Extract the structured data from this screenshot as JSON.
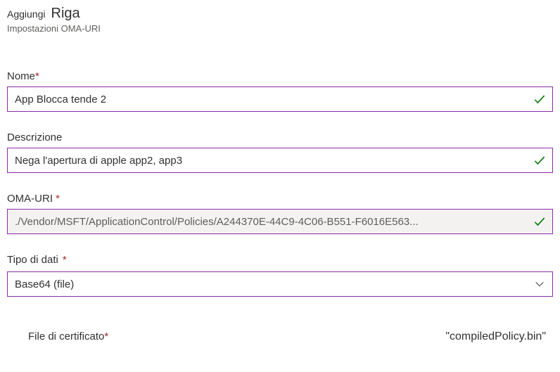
{
  "header": {
    "prefix": "Aggiungi",
    "title": "Riga",
    "subtitle": "Impostazioni OMA-URI"
  },
  "fields": {
    "name": {
      "label": "Nome",
      "required": "*",
      "value": "App Blocca tende 2"
    },
    "description": {
      "label": "Descrizione",
      "value": "Nega l'apertura di apple app2, app3"
    },
    "omauri": {
      "label": "OMA-URI ",
      "required": "*",
      "value": "./Vendor/MSFT/ApplicationControl/Policies/A244370E-44C9-4C06-B551-F6016E563..."
    },
    "datatype": {
      "label": "Tipo di dati",
      "required": "*",
      "value": "Base64 (file)"
    },
    "certfile": {
      "label": "File di certificato",
      "required": "*",
      "filename": "\"compiledPolicy.bin\""
    }
  }
}
